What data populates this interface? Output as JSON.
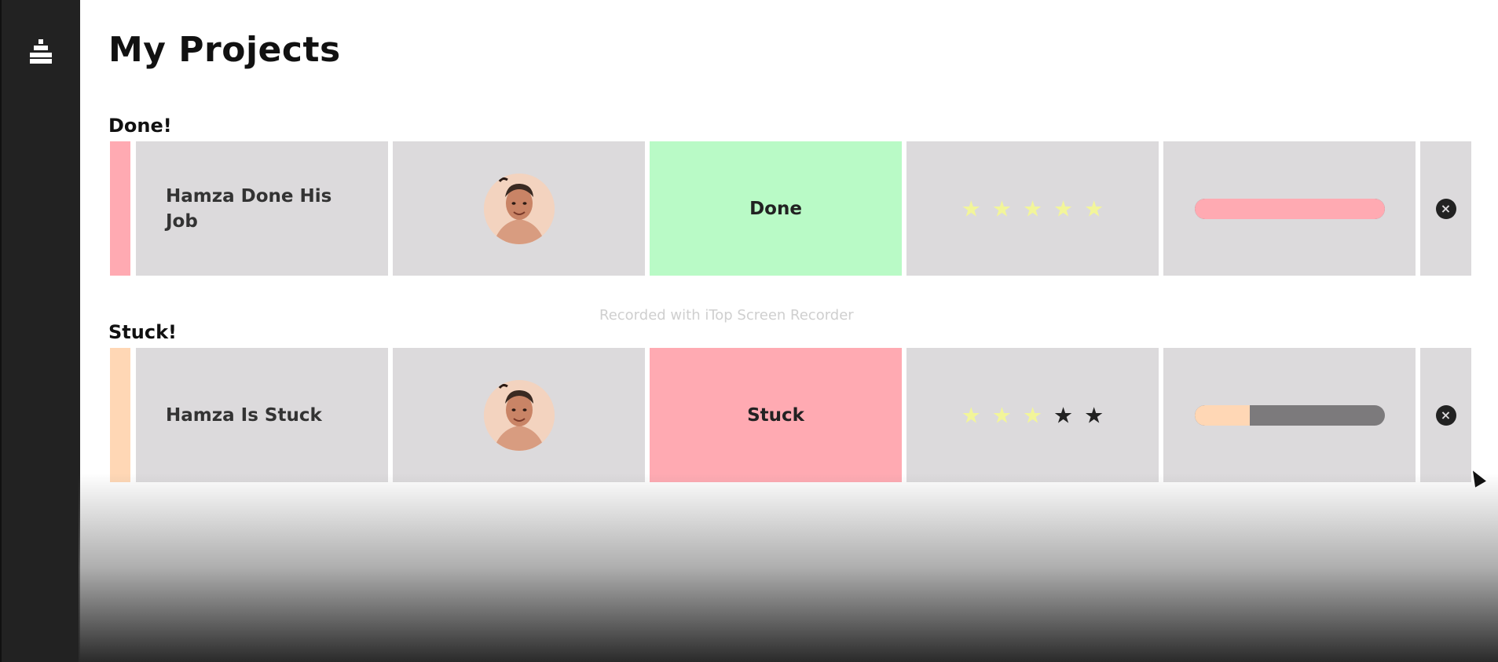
{
  "page": {
    "title": "My Projects"
  },
  "sidebar": {
    "icon": "user-stack-icon"
  },
  "watermark": "Recorded with iTop Screen Recorder",
  "groups": [
    {
      "title": "Done!",
      "rows": [
        {
          "name": "Hamza Done His Job",
          "accent_color": "#ffaab2",
          "status": "Done",
          "status_color": "#b9fac6",
          "rating": 5,
          "rating_max": 5,
          "progress": 1.0,
          "progress_color": "#ffaab2",
          "close_icon": "close-circle-icon"
        }
      ]
    },
    {
      "title": "Stuck!",
      "rows": [
        {
          "name": "Hamza Is Stuck",
          "accent_color": "#ffd7b5",
          "status": "Stuck",
          "status_color": "#ffaab2",
          "rating": 3,
          "rating_max": 5,
          "progress": 0.29,
          "progress_color": "#ffd7b5",
          "close_icon": "close-circle-icon"
        }
      ]
    }
  ]
}
